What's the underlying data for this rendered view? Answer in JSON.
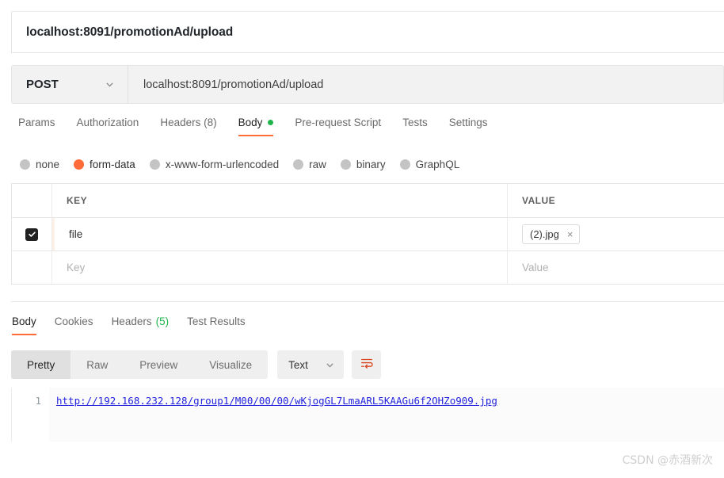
{
  "request": {
    "title": "localhost:8091/promotionAd/upload",
    "method": "POST",
    "url": "localhost:8091/promotionAd/upload",
    "tabs": [
      {
        "label": "Params",
        "active": false
      },
      {
        "label": "Authorization",
        "active": false
      },
      {
        "label": "Headers (8)",
        "active": false
      },
      {
        "label": "Body",
        "active": true,
        "dot": "green"
      },
      {
        "label": "Pre-request Script",
        "active": false
      },
      {
        "label": "Tests",
        "active": false
      },
      {
        "label": "Settings",
        "active": false
      }
    ],
    "body_types": [
      {
        "label": "none",
        "selected": false
      },
      {
        "label": "form-data",
        "selected": true
      },
      {
        "label": "x-www-form-urlencoded",
        "selected": false
      },
      {
        "label": "raw",
        "selected": false
      },
      {
        "label": "binary",
        "selected": false
      },
      {
        "label": "GraphQL",
        "selected": false
      }
    ],
    "table": {
      "headers": {
        "key": "KEY",
        "value": "VALUE"
      },
      "rows": [
        {
          "checked": true,
          "key": "file",
          "file_chip": "(2).jpg",
          "remove": "×"
        }
      ],
      "placeholder_row": {
        "key": "Key",
        "value": "Value"
      }
    }
  },
  "response": {
    "tabs": [
      {
        "label": "Body",
        "active": true
      },
      {
        "label": "Cookies",
        "active": false
      },
      {
        "label": "Headers",
        "count": "(5)",
        "active": false
      },
      {
        "label": "Test Results",
        "active": false
      }
    ],
    "view_modes": [
      {
        "label": "Pretty",
        "active": true
      },
      {
        "label": "Raw",
        "active": false
      },
      {
        "label": "Preview",
        "active": false
      },
      {
        "label": "Visualize",
        "active": false
      }
    ],
    "format": "Text",
    "line_number": "1",
    "body_text": "http://192.168.232.128/group1/M00/00/00/wKjogGL7LmaARL5KAAGu6f2OHZo909.jpg"
  },
  "watermark": "CSDN @赤酒新次",
  "colors": {
    "accent": "#ff6c37",
    "success": "#21b44b",
    "link": "#2323dd"
  }
}
